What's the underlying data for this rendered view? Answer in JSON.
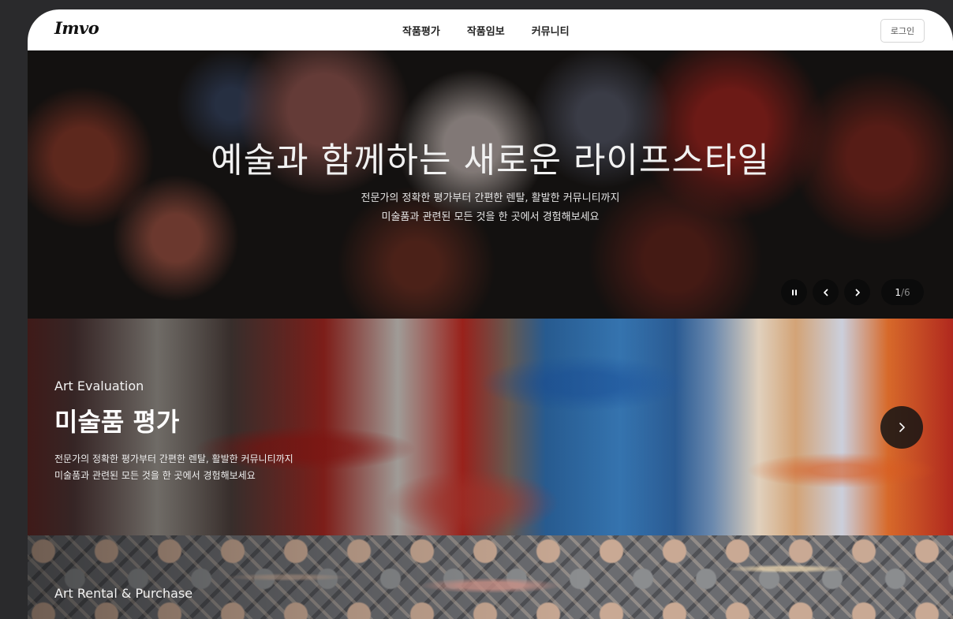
{
  "nav": {
    "logo": "Imvo",
    "menu": [
      "작품평가",
      "작품임보",
      "커뮤니티"
    ],
    "login_label": "로그인"
  },
  "hero": {
    "title": "예술과 함께하는 새로운 라이프스타일",
    "subtitle_lines": [
      "전문가의 정확한 평가부터 간편한 렌탈, 활발한 커뮤니티까지",
      "미술품과 관련된 모든 것을 한 곳에서 경험해보세요"
    ],
    "slider": {
      "current": "1",
      "separator": "/",
      "total": "6"
    }
  },
  "sections": [
    {
      "eyebrow": "Art Evaluation",
      "title": "미술품 평가",
      "desc_lines": [
        "전문가의 정확한 평가부터 간편한 렌탈, 활발한 커뮤니티까지",
        "미술품과 관련된 모든 것을 한 곳에서 경험해보세요"
      ]
    },
    {
      "eyebrow": "Art Rental & Purchase"
    }
  ],
  "icons": {
    "pause": "pause-icon",
    "prev": "chevron-left-icon",
    "next": "chevron-right-icon",
    "section_arrow": "chevron-right-icon"
  }
}
